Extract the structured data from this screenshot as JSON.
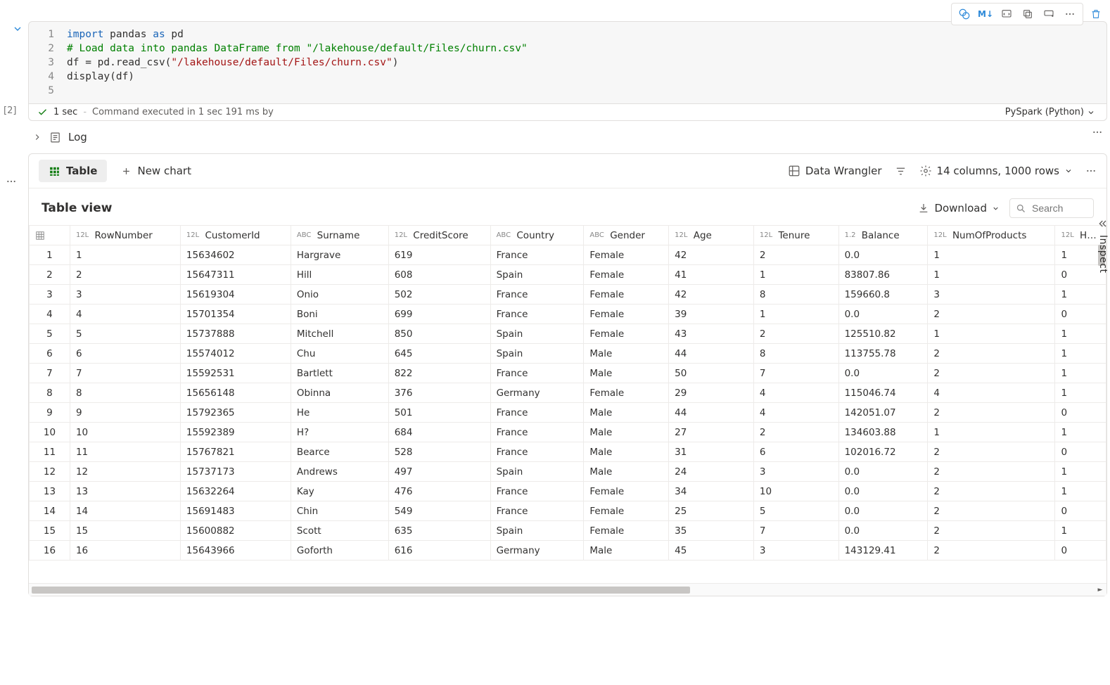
{
  "exec_index": "[2]",
  "code": {
    "lines": [
      {
        "n": "1",
        "html": "<span class='kw'>import</span> pandas <span class='kw'>as</span> pd"
      },
      {
        "n": "2",
        "html": "<span class='cm'># Load data into pandas DataFrame from \"/lakehouse/default/Files/churn.csv\"</span>"
      },
      {
        "n": "3",
        "html": "df = pd.read_csv(<span class='str'>\"/lakehouse/default/Files/churn.csv\"</span>)"
      },
      {
        "n": "4",
        "html": "display(df)"
      },
      {
        "n": "5",
        "html": ""
      }
    ]
  },
  "status": {
    "time_short": "1 sec",
    "msg": "Command executed in 1 sec 191 ms by",
    "lang": "PySpark (Python)"
  },
  "log_label": "Log",
  "output": {
    "tabs": {
      "table": "Table",
      "chart": "New chart"
    },
    "wrangler": "Data Wrangler",
    "summary": "14 columns, 1000 rows",
    "title": "Table view",
    "download": "Download",
    "search_ph": "Search",
    "inspect": "Inspect"
  },
  "table": {
    "columns": [
      {
        "type": "12L",
        "name": "RowNumber"
      },
      {
        "type": "12L",
        "name": "CustomerId"
      },
      {
        "type": "ABC",
        "name": "Surname"
      },
      {
        "type": "12L",
        "name": "CreditScore"
      },
      {
        "type": "ABC",
        "name": "Country"
      },
      {
        "type": "ABC",
        "name": "Gender"
      },
      {
        "type": "12L",
        "name": "Age"
      },
      {
        "type": "12L",
        "name": "Tenure"
      },
      {
        "type": "1.2",
        "name": "Balance"
      },
      {
        "type": "12L",
        "name": "NumOfProducts"
      },
      {
        "type": "12L",
        "name": "HasC"
      }
    ],
    "rows": [
      [
        "1",
        "1",
        "15634602",
        "Hargrave",
        "619",
        "France",
        "Female",
        "42",
        "2",
        "0.0",
        "1",
        "1"
      ],
      [
        "2",
        "2",
        "15647311",
        "Hill",
        "608",
        "Spain",
        "Female",
        "41",
        "1",
        "83807.86",
        "1",
        "0"
      ],
      [
        "3",
        "3",
        "15619304",
        "Onio",
        "502",
        "France",
        "Female",
        "42",
        "8",
        "159660.8",
        "3",
        "1"
      ],
      [
        "4",
        "4",
        "15701354",
        "Boni",
        "699",
        "France",
        "Female",
        "39",
        "1",
        "0.0",
        "2",
        "0"
      ],
      [
        "5",
        "5",
        "15737888",
        "Mitchell",
        "850",
        "Spain",
        "Female",
        "43",
        "2",
        "125510.82",
        "1",
        "1"
      ],
      [
        "6",
        "6",
        "15574012",
        "Chu",
        "645",
        "Spain",
        "Male",
        "44",
        "8",
        "113755.78",
        "2",
        "1"
      ],
      [
        "7",
        "7",
        "15592531",
        "Bartlett",
        "822",
        "France",
        "Male",
        "50",
        "7",
        "0.0",
        "2",
        "1"
      ],
      [
        "8",
        "8",
        "15656148",
        "Obinna",
        "376",
        "Germany",
        "Female",
        "29",
        "4",
        "115046.74",
        "4",
        "1"
      ],
      [
        "9",
        "9",
        "15792365",
        "He",
        "501",
        "France",
        "Male",
        "44",
        "4",
        "142051.07",
        "2",
        "0"
      ],
      [
        "10",
        "10",
        "15592389",
        "H?",
        "684",
        "France",
        "Male",
        "27",
        "2",
        "134603.88",
        "1",
        "1"
      ],
      [
        "11",
        "11",
        "15767821",
        "Bearce",
        "528",
        "France",
        "Male",
        "31",
        "6",
        "102016.72",
        "2",
        "0"
      ],
      [
        "12",
        "12",
        "15737173",
        "Andrews",
        "497",
        "Spain",
        "Male",
        "24",
        "3",
        "0.0",
        "2",
        "1"
      ],
      [
        "13",
        "13",
        "15632264",
        "Kay",
        "476",
        "France",
        "Female",
        "34",
        "10",
        "0.0",
        "2",
        "1"
      ],
      [
        "14",
        "14",
        "15691483",
        "Chin",
        "549",
        "France",
        "Female",
        "25",
        "5",
        "0.0",
        "2",
        "0"
      ],
      [
        "15",
        "15",
        "15600882",
        "Scott",
        "635",
        "Spain",
        "Female",
        "35",
        "7",
        "0.0",
        "2",
        "1"
      ],
      [
        "16",
        "16",
        "15643966",
        "Goforth",
        "616",
        "Germany",
        "Male",
        "45",
        "3",
        "143129.41",
        "2",
        "0"
      ]
    ]
  },
  "chart_data": {
    "type": "table",
    "columns": [
      "RowNumber",
      "CustomerId",
      "Surname",
      "CreditScore",
      "Country",
      "Gender",
      "Age",
      "Tenure",
      "Balance",
      "NumOfProducts",
      "HasC"
    ],
    "rows": [
      [
        1,
        15634602,
        "Hargrave",
        619,
        "France",
        "Female",
        42,
        2,
        0.0,
        1,
        1
      ],
      [
        2,
        15647311,
        "Hill",
        608,
        "Spain",
        "Female",
        41,
        1,
        83807.86,
        1,
        0
      ],
      [
        3,
        15619304,
        "Onio",
        502,
        "France",
        "Female",
        42,
        8,
        159660.8,
        3,
        1
      ],
      [
        4,
        15701354,
        "Boni",
        699,
        "France",
        "Female",
        39,
        1,
        0.0,
        2,
        0
      ],
      [
        5,
        15737888,
        "Mitchell",
        850,
        "Spain",
        "Female",
        43,
        2,
        125510.82,
        1,
        1
      ],
      [
        6,
        15574012,
        "Chu",
        645,
        "Spain",
        "Male",
        44,
        8,
        113755.78,
        2,
        1
      ],
      [
        7,
        15592531,
        "Bartlett",
        822,
        "France",
        "Male",
        50,
        7,
        0.0,
        2,
        1
      ],
      [
        8,
        15656148,
        "Obinna",
        376,
        "Germany",
        "Female",
        29,
        4,
        115046.74,
        4,
        1
      ],
      [
        9,
        15792365,
        "He",
        501,
        "France",
        "Male",
        44,
        4,
        142051.07,
        2,
        0
      ],
      [
        10,
        15592389,
        "H?",
        684,
        "France",
        "Male",
        27,
        2,
        134603.88,
        1,
        1
      ],
      [
        11,
        15767821,
        "Bearce",
        528,
        "France",
        "Male",
        31,
        6,
        102016.72,
        2,
        0
      ],
      [
        12,
        15737173,
        "Andrews",
        497,
        "Spain",
        "Male",
        24,
        3,
        0.0,
        2,
        1
      ],
      [
        13,
        15632264,
        "Kay",
        476,
        "France",
        "Female",
        34,
        10,
        0.0,
        2,
        1
      ],
      [
        14,
        15691483,
        "Chin",
        549,
        "France",
        "Female",
        25,
        5,
        0.0,
        2,
        0
      ],
      [
        15,
        15600882,
        "Scott",
        635,
        "Spain",
        "Female",
        35,
        7,
        0.0,
        2,
        1
      ],
      [
        16,
        15643966,
        "Goforth",
        616,
        "Germany",
        "Male",
        45,
        3,
        143129.41,
        2,
        0
      ]
    ]
  }
}
